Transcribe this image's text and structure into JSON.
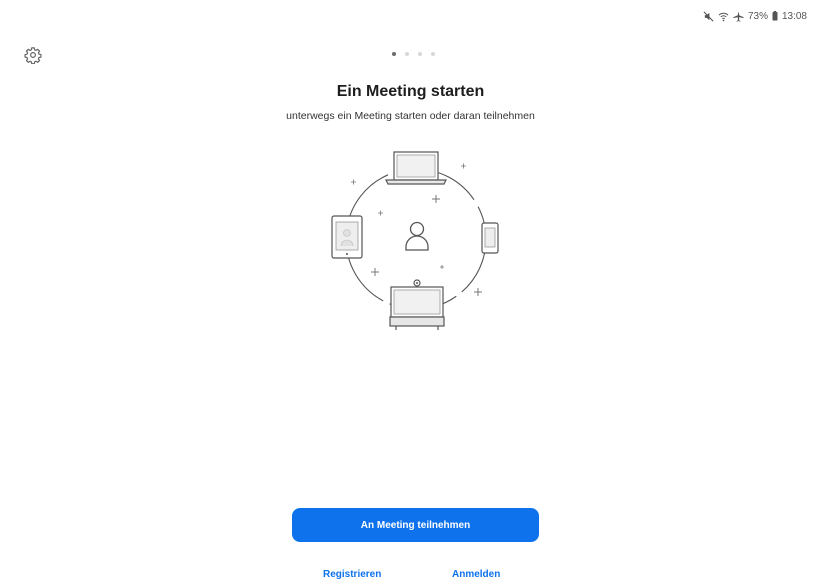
{
  "status_bar": {
    "battery": "73%",
    "time": "13:08",
    "icons": [
      "mute-icon",
      "wifi-icon",
      "airplane-mode-icon",
      "battery-icon"
    ]
  },
  "settings": {
    "icon": "gear-icon"
  },
  "pager": {
    "count": 4,
    "active_index": 0
  },
  "onboarding": {
    "title": "Ein Meeting starten",
    "subtitle": "unterwegs ein Meeting starten oder daran teilnehmen"
  },
  "actions": {
    "join_label": "An Meeting teilnehmen",
    "register_label": "Registrieren",
    "login_label": "Anmelden"
  },
  "colors": {
    "accent": "#0e72ed",
    "background": "#ffffff",
    "illustration_stroke": "#666666"
  }
}
